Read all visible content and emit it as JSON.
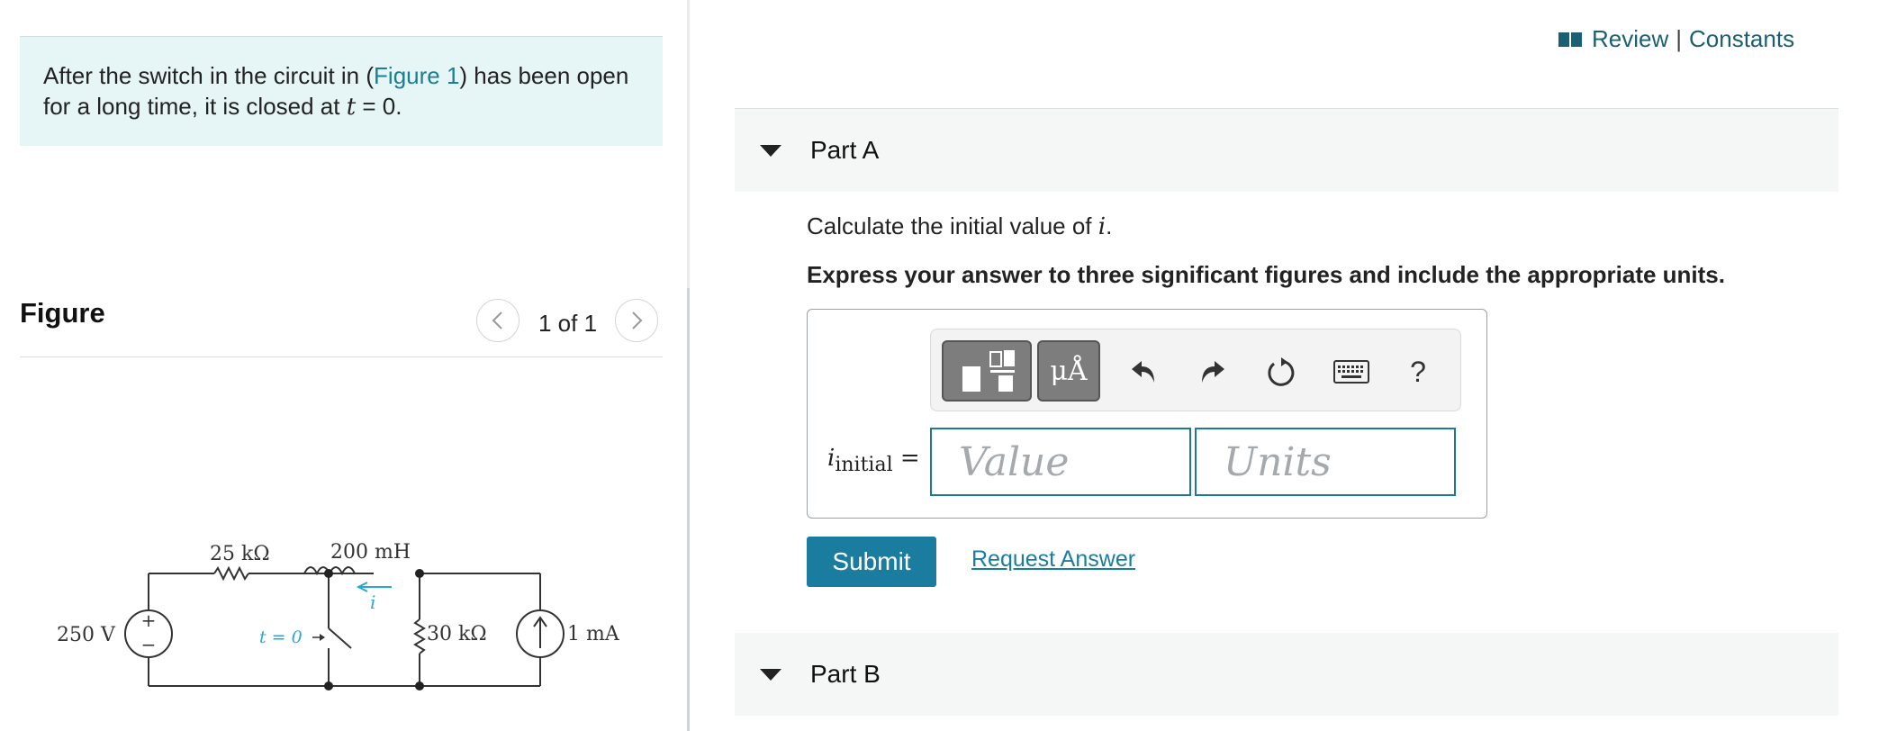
{
  "intro": {
    "before": "After the switch in the circuit in (",
    "link": "Figure 1",
    "after": ") has been open for a long time, it is closed at ",
    "var": "t",
    "equation": " = 0."
  },
  "figure_panel": {
    "title": "Figure",
    "count": "1 of 1"
  },
  "circuit": {
    "source_voltage": "250 V",
    "resistor1": "25 kΩ",
    "inductor": "200 mH",
    "current_label": "i",
    "switch_label": "t = 0",
    "resistor2": "30 kΩ",
    "current_source": "1 mA"
  },
  "header": {
    "review": "Review",
    "separator": "|",
    "constants": "Constants"
  },
  "partA": {
    "title": "Part A",
    "question_prefix": "Calculate the initial value of ",
    "question_var": "i",
    "question_suffix": ".",
    "instruction": "Express your answer to three significant figures and include the appropriate units.",
    "units_button": "μÅ",
    "help_button": "?",
    "variable": "i",
    "variable_sub": "initial",
    "equals": " =",
    "value_placeholder": "Value",
    "units_placeholder": "Units",
    "submit": "Submit",
    "request": "Request Answer"
  },
  "partB": {
    "title": "Part B"
  },
  "colors": {
    "accent": "#1a7da0",
    "intro_bg": "#e6f5f6",
    "input_border": "#1e7a90"
  }
}
